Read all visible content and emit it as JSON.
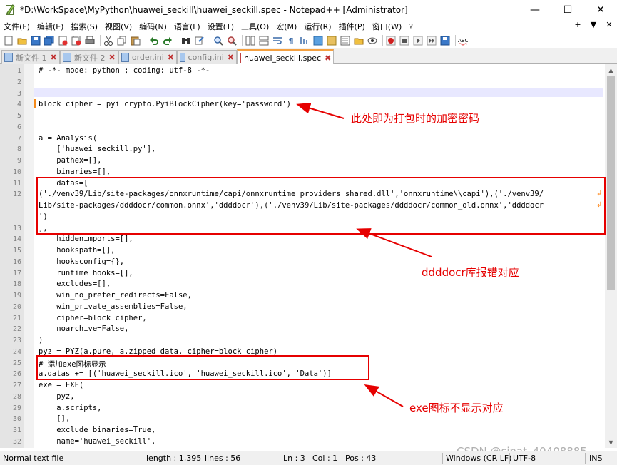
{
  "window": {
    "title": "*D:\\WorkSpace\\MyPython\\huawei_seckill\\huawei_seckill.spec - Notepad++ [Administrator]",
    "minimize": "—",
    "maximize": "☐",
    "close": "✕"
  },
  "menu": {
    "items": [
      "文件(F)",
      "编辑(E)",
      "搜索(S)",
      "视图(V)",
      "编码(N)",
      "语言(L)",
      "设置(T)",
      "工具(O)",
      "宏(M)",
      "运行(R)",
      "插件(P)",
      "窗口(W)",
      "?"
    ],
    "right": [
      "+",
      "▼",
      "✕"
    ]
  },
  "tabs": [
    {
      "label": "新文件 1",
      "close": "✖",
      "active": false
    },
    {
      "label": "新文件 2",
      "close": "✖",
      "active": false
    },
    {
      "label": "order.ini",
      "close": "✖",
      "active": false
    },
    {
      "label": "config.ini",
      "close": "✖",
      "active": false
    },
    {
      "label": "huawei_seckill.spec",
      "close": "✖",
      "active": true
    }
  ],
  "editor": {
    "lines": [
      {
        "n": "1",
        "text": "# -*- mode: python ; coding: utf-8 -*-"
      },
      {
        "n": "2",
        "text": ""
      },
      {
        "n": "3",
        "text": ""
      },
      {
        "n": "4",
        "text": "block_cipher = pyi_crypto.PyiBlockCipher(key='password')"
      },
      {
        "n": "5",
        "text": ""
      },
      {
        "n": "6",
        "text": ""
      },
      {
        "n": "7",
        "text": "a = Analysis("
      },
      {
        "n": "8",
        "text": "    ['huawei_seckill.py'],"
      },
      {
        "n": "9",
        "text": "    pathex=[],"
      },
      {
        "n": "10",
        "text": "    binaries=[],"
      },
      {
        "n": "11",
        "text": "    datas=["
      },
      {
        "n": "12",
        "text": "('./venv39/Lib/site-packages/onnxruntime/capi/onnxruntime_providers_shared.dll','onnxruntime\\\\capi'),('./venv39/"
      },
      {
        "n": "",
        "text": "Lib/site-packages/ddddocr/common.onnx','ddddocr'),('./venv39/Lib/site-packages/ddddocr/common_old.onnx','ddddocr"
      },
      {
        "n": "",
        "text": "')"
      },
      {
        "n": "13",
        "text": "],"
      },
      {
        "n": "14",
        "text": "    hiddenimports=[],"
      },
      {
        "n": "15",
        "text": "    hookspath=[],"
      },
      {
        "n": "16",
        "text": "    hooksconfig={},"
      },
      {
        "n": "17",
        "text": "    runtime_hooks=[],"
      },
      {
        "n": "18",
        "text": "    excludes=[],"
      },
      {
        "n": "19",
        "text": "    win_no_prefer_redirects=False,"
      },
      {
        "n": "20",
        "text": "    win_private_assemblies=False,"
      },
      {
        "n": "21",
        "text": "    cipher=block_cipher,"
      },
      {
        "n": "22",
        "text": "    noarchive=False,"
      },
      {
        "n": "23",
        "text": ")"
      },
      {
        "n": "24",
        "text": "pyz = PYZ(a.pure, a.zipped_data, cipher=block_cipher)"
      },
      {
        "n": "25",
        "text": "# 添加exe图标显示"
      },
      {
        "n": "26",
        "text": "a.datas += [('huawei_seckill.ico', 'huawei_seckill.ico', 'Data')]"
      },
      {
        "n": "27",
        "text": "exe = EXE("
      },
      {
        "n": "28",
        "text": "    pyz,"
      },
      {
        "n": "29",
        "text": "    a.scripts,"
      },
      {
        "n": "30",
        "text": "    [],"
      },
      {
        "n": "31",
        "text": "    exclude_binaries=True,"
      },
      {
        "n": "32",
        "text": "    name='huawei_seckill',"
      }
    ],
    "wrap_symbol": "↲"
  },
  "annotations": {
    "password_note": "此处即为打包时的加密密码",
    "ddddocr_note": "ddddocr库报错对应",
    "icon_note": "exe图标不显示对应",
    "color": "#e60000"
  },
  "statusbar": {
    "mode": "Normal text file",
    "length": "length : 1,395",
    "lines": "lines : 56",
    "ln": "Ln : 3",
    "col": "Col : 1",
    "pos": "Pos : 43",
    "eol": "Windows (CR LF)",
    "encoding": "UTF-8",
    "ins": "INS"
  },
  "watermark": "CSDN @sinat_40408885"
}
